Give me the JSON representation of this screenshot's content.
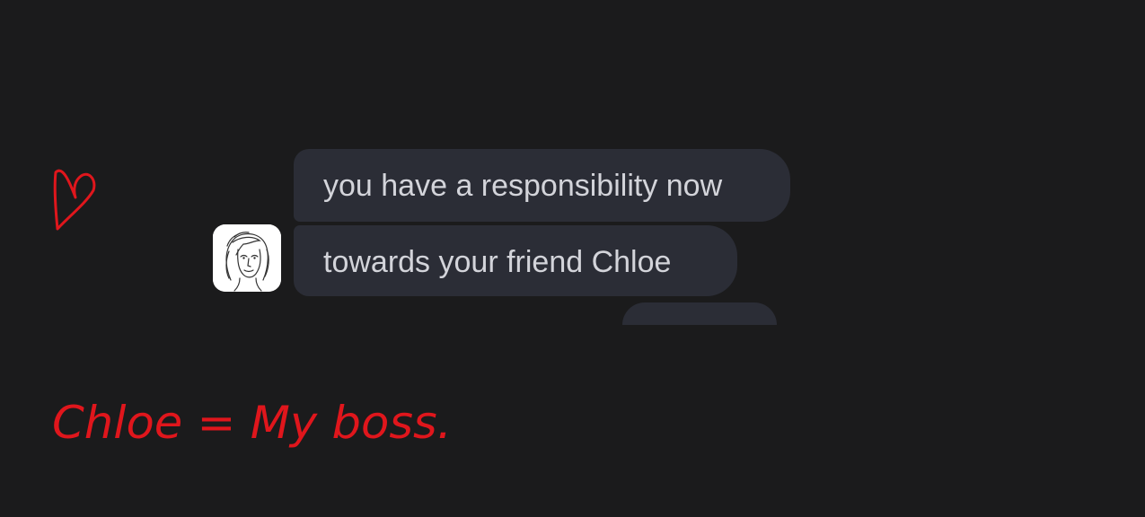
{
  "conversation": {
    "messages": [
      {
        "sender": "contact",
        "text": "you have a responsibility now"
      },
      {
        "sender": "contact",
        "text": "towards your friend Chloe"
      }
    ]
  },
  "annotations": {
    "note": "Chloe = My boss.",
    "ink_color": "#e0161c"
  },
  "colors": {
    "background": "#1b1b1c",
    "bubble_background": "#2b2d36",
    "bubble_text": "#d3d4da"
  },
  "icons": {
    "avatar": "sketched-woman-portrait",
    "heart": "hand-drawn-heart-icon"
  }
}
